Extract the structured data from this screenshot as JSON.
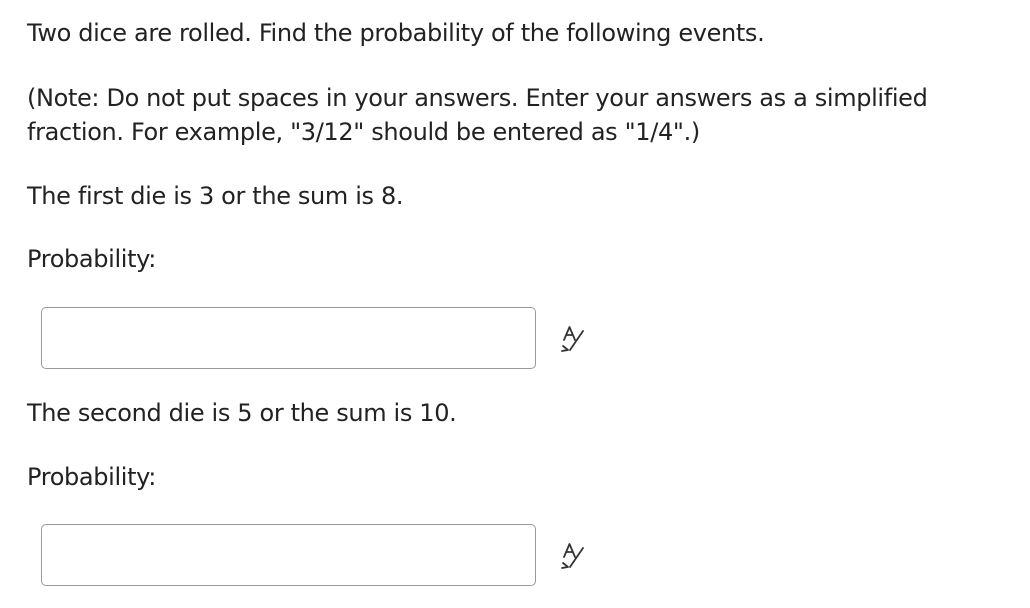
{
  "question": {
    "intro": "Two dice are rolled. Find the probability of the following events.",
    "note_line1": "(Note: Do not put spaces in your answers. Enter your answers as a simplified",
    "note_line2": "fraction. For example, \"3/12\" should be entered as \"1/4\".)"
  },
  "parts": [
    {
      "event": "The first die is 3 or the sum is 8.",
      "label": "Probability:",
      "value": "",
      "icon": "spell-check-icon"
    },
    {
      "event": "The second die is 5 or the sum is 10.",
      "label": "Probability:",
      "value": "",
      "icon": "spell-check-icon"
    }
  ],
  "colors": {
    "text": "#222222",
    "input_border": "#9a9a9a",
    "icon": "#333333"
  }
}
